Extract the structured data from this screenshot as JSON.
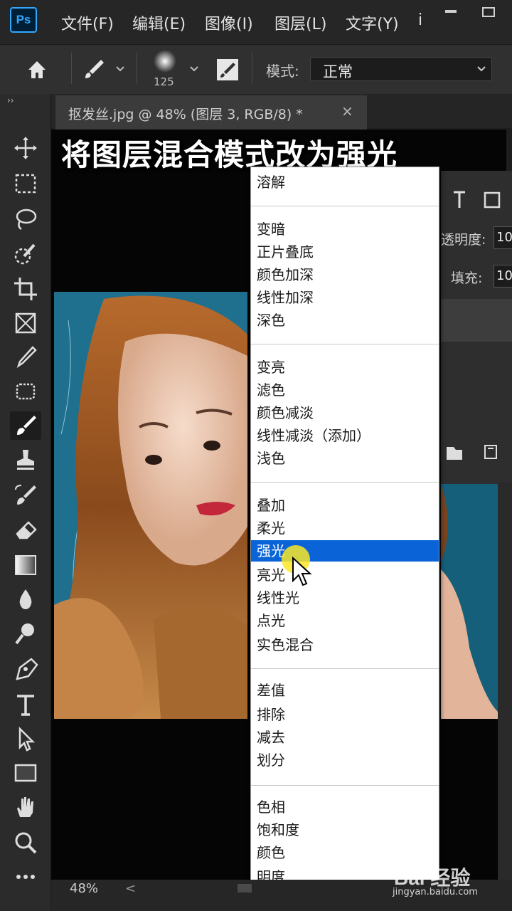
{
  "app": {
    "logo": "Ps",
    "menu": [
      "文件(F)",
      "编辑(E)",
      "图像(I)",
      "图层(L)",
      "文字(Y)",
      "i"
    ]
  },
  "options_bar": {
    "brush_size": "125",
    "mode_label": "模式:",
    "mode_value": "正常"
  },
  "document": {
    "tab_title": "抠发丝.jpg @ 48% (图层 3, RGB/8) *",
    "close_glyph": "×"
  },
  "caption": "将图层混合模式改为强光",
  "layers_panel": {
    "opacity_label": "透明度:",
    "opacity_value": "10",
    "fill_label": "填充:",
    "fill_value": "10"
  },
  "blend_menu": {
    "groups": [
      [
        "溶解"
      ],
      [
        "变暗",
        "正片叠底",
        "颜色加深",
        "线性加深",
        "深色"
      ],
      [
        "变亮",
        "滤色",
        "颜色减淡",
        "线性减淡（添加）",
        "浅色"
      ],
      [
        "叠加",
        "柔光",
        "强光",
        "亮光",
        "线性光",
        "点光",
        "实色混合"
      ],
      [
        "差值",
        "排除",
        "减去",
        "划分"
      ],
      [
        "色相",
        "饱和度",
        "颜色",
        "明度"
      ]
    ],
    "selected": "强光",
    "selected_color": "#0a64d8"
  },
  "status_bar": {
    "zoom": "48%",
    "scroll_glyph": "<"
  },
  "watermark": {
    "main": "Bai 经验",
    "sub": "jingyan.baidu.com"
  },
  "colors": {
    "accent": "#31a8ff",
    "photo_bg": "#1f6f8e"
  }
}
